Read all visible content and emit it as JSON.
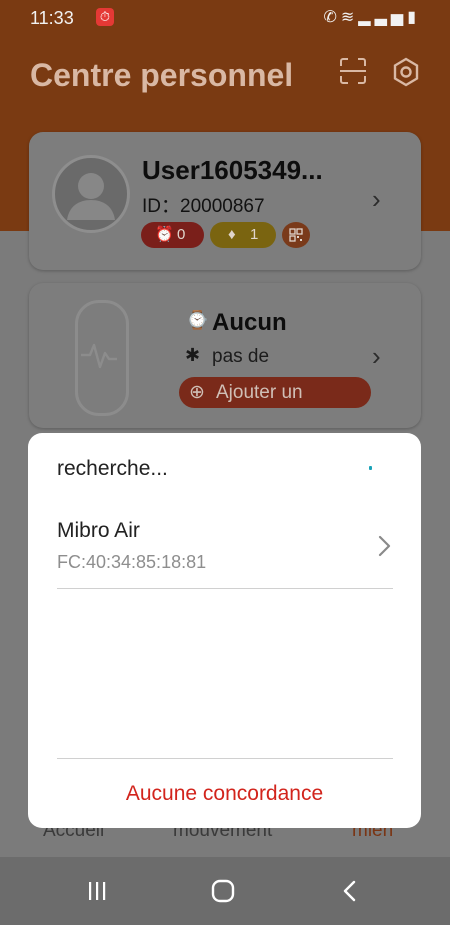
{
  "status_bar": {
    "time": "11:33",
    "notification_icon": "alarm-app-icon",
    "icons": [
      "wifi-call-icon",
      "wifi-icon",
      "signal-icon",
      "battery-icon"
    ]
  },
  "header": {
    "title": "Centre personnel",
    "icons": [
      "scan-icon",
      "gear-icon"
    ]
  },
  "profile": {
    "username": "User1605349...",
    "id_text": "ID：20000867",
    "badges": [
      {
        "icon": "alarm-icon",
        "value": "0",
        "color": "#e53935"
      },
      {
        "icon": "diamond-icon",
        "value": "1",
        "color": "#f2c31a"
      },
      {
        "icon": "qr-code-icon",
        "color": "#e06a2a"
      }
    ]
  },
  "device": {
    "name": "Aucun",
    "status": "pas de",
    "add_button": "Ajouter un"
  },
  "tabs": [
    {
      "label": "Accueil"
    },
    {
      "label": "mouvement"
    },
    {
      "label": "mien"
    }
  ],
  "dialog": {
    "title": "recherche...",
    "devices": [
      {
        "name": "Mibro Air",
        "mac": "FC:40:34:85:18:81"
      }
    ],
    "footer_button": "Aucune concordance"
  },
  "colors": {
    "accent": "#e8601c",
    "danger_text": "#d2241c"
  }
}
